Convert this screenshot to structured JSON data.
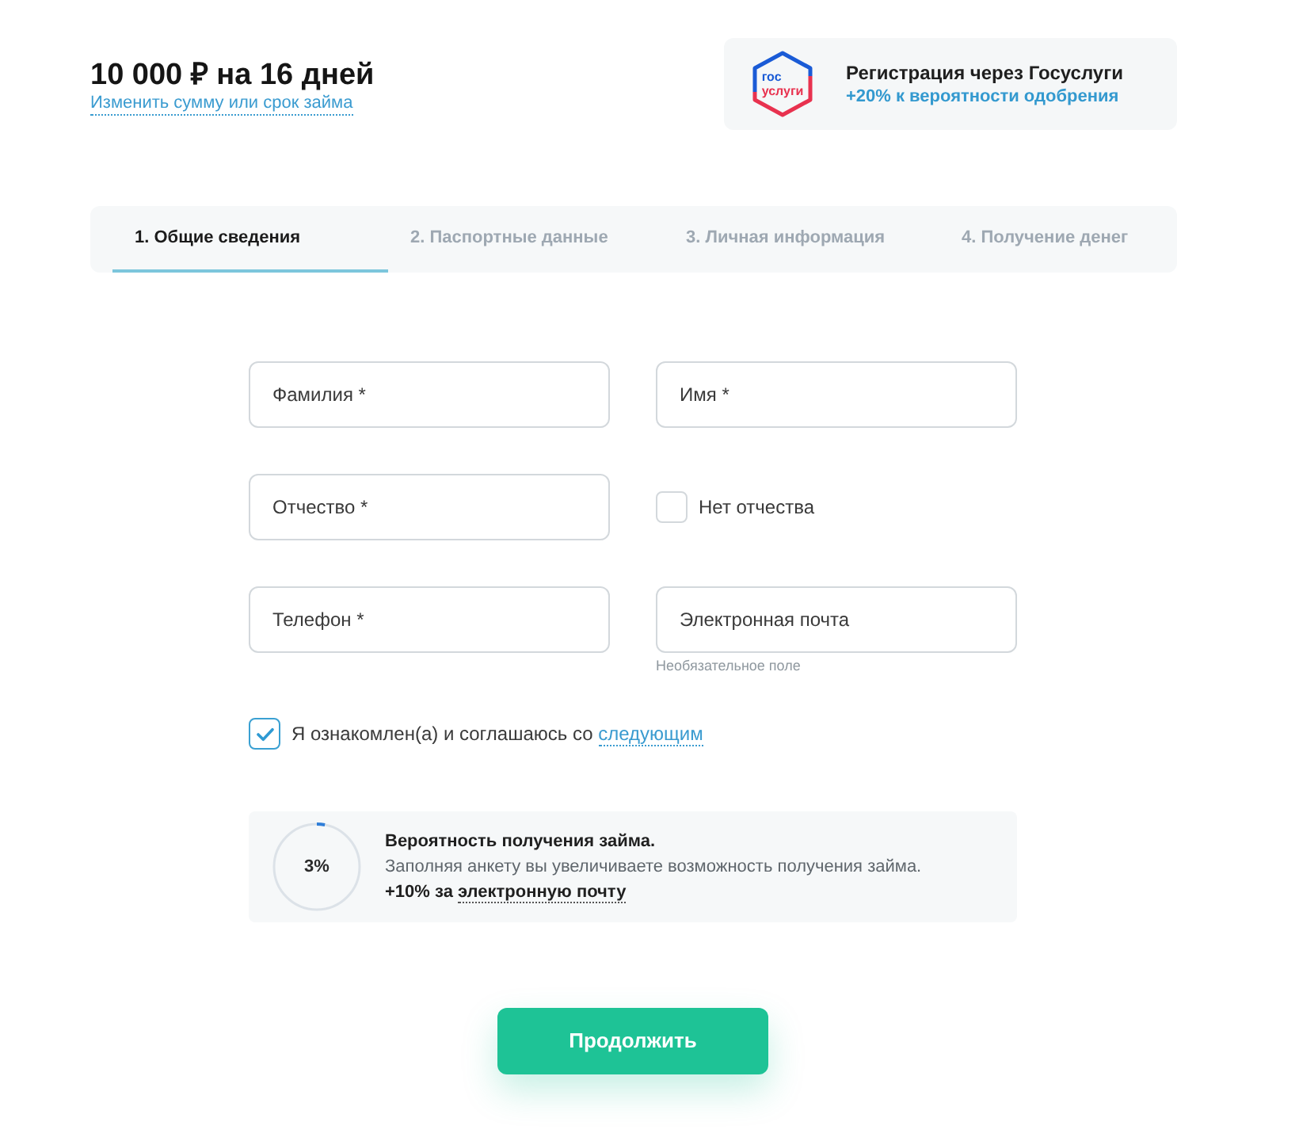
{
  "loan": {
    "title": "10 000 ₽ на 16 дней",
    "change_link": "Изменить сумму или срок займа"
  },
  "gosuslugi": {
    "logo_top": "гос",
    "logo_bottom": "услуги",
    "title": "Регистрация через Госуслуги",
    "bonus": "+20% к вероятности одобрения"
  },
  "tabs": [
    {
      "label": "1. Общие сведения",
      "selected": true
    },
    {
      "label": "2. Паспортные данные",
      "selected": false
    },
    {
      "label": "3. Личная информация",
      "selected": false
    },
    {
      "label": "4. Получение денег",
      "selected": false
    }
  ],
  "fields": [
    {
      "kind": "input",
      "placeholder": "Фамилия *"
    },
    {
      "kind": "input",
      "placeholder": "Имя *"
    },
    {
      "kind": "input",
      "placeholder": "Отчество *"
    },
    {
      "kind": "checkbox",
      "label": "Нет отчества",
      "checked": false
    },
    {
      "kind": "input",
      "placeholder": "Телефон *"
    },
    {
      "kind": "input",
      "placeholder": "Электронная почта",
      "hint": "Необязательное поле"
    }
  ],
  "consent": {
    "checked": true,
    "text": "Я ознакомлен(а) и соглашаюсь со",
    "link": "следующим"
  },
  "probability": {
    "level": 0.03,
    "reading": "3%",
    "title": "Вероятность получения займа.",
    "description": "Заполняя анкету вы увеличиваете возможность получения займа.",
    "bonus": "+10% за",
    "bonus_link": "электронную почту"
  },
  "submit": "Продолжить"
}
